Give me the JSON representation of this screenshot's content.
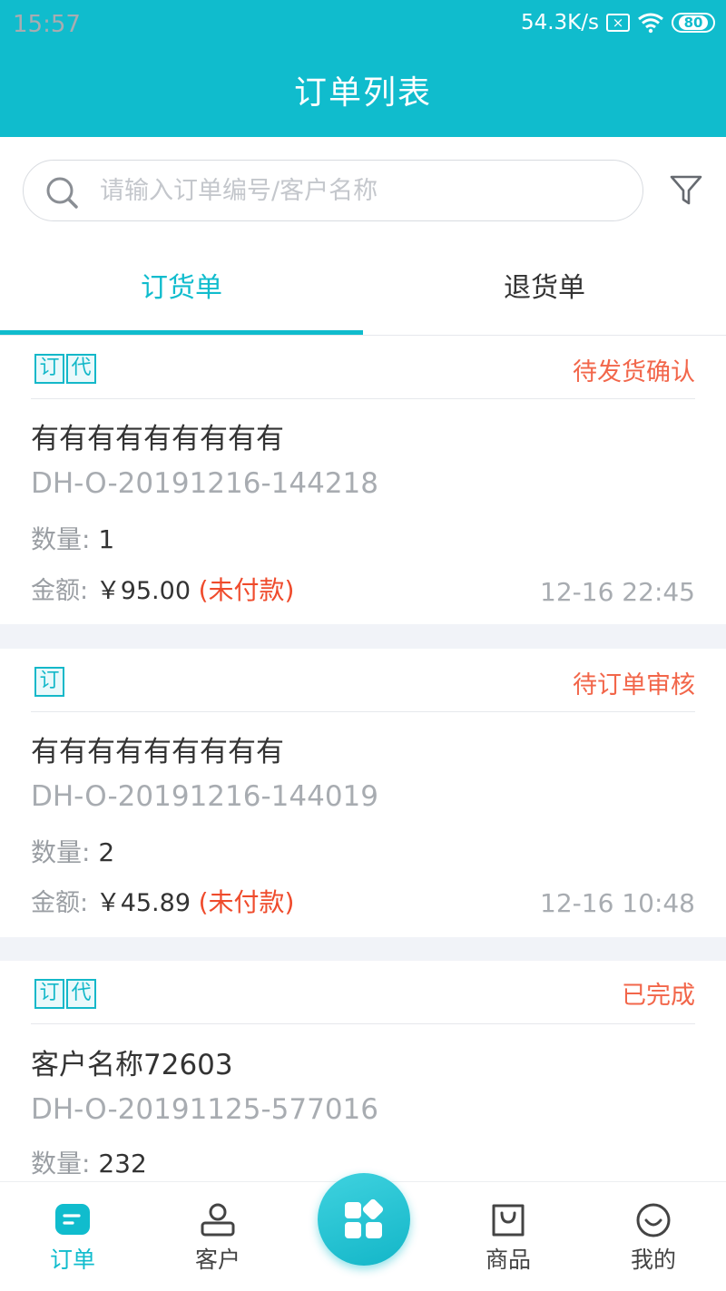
{
  "status_bar": {
    "time": "15:57",
    "network_speed": "54.3K/s",
    "sim_icon_text": "×",
    "battery": "80"
  },
  "app_bar": {
    "title": "订单列表"
  },
  "search": {
    "placeholder": "请输入订单编号/客户名称",
    "value": ""
  },
  "tabs": [
    {
      "label": "订货单",
      "active": true
    },
    {
      "label": "退货单",
      "active": false
    }
  ],
  "orders": [
    {
      "badges": [
        "订",
        "代"
      ],
      "status": "待发货确认",
      "customer": "有有有有有有有有有",
      "order_no": "DH-O-20191216-144218",
      "qty_label": "数量:",
      "qty": "1",
      "amount_label": "金额:",
      "amount": "￥95.00",
      "payment_status": "(未付款)",
      "time": "12-16 22:45"
    },
    {
      "badges": [
        "订"
      ],
      "status": "待订单审核",
      "customer": "有有有有有有有有有",
      "order_no": "DH-O-20191216-144019",
      "qty_label": "数量:",
      "qty": "2",
      "amount_label": "金额:",
      "amount": "￥45.89",
      "payment_status": "(未付款)",
      "time": "12-16 10:48"
    },
    {
      "badges": [
        "订",
        "代"
      ],
      "status": "已完成",
      "customer": "客户名称72603",
      "order_no": "DH-O-20191125-577016",
      "qty_label": "数量:",
      "qty": "232"
    }
  ],
  "bottom_nav": [
    {
      "label": "订单",
      "icon": "order-icon",
      "active": true
    },
    {
      "label": "客户",
      "icon": "customer-icon",
      "active": false
    },
    {
      "label": "商品",
      "icon": "goods-bag-icon",
      "active": false
    },
    {
      "label": "我的",
      "icon": "smile-icon",
      "active": false
    }
  ],
  "colors": {
    "primary": "#10bccd",
    "status": "#f2664a",
    "unpaid": "#ef4b2c",
    "muted": "#a8acb1"
  }
}
